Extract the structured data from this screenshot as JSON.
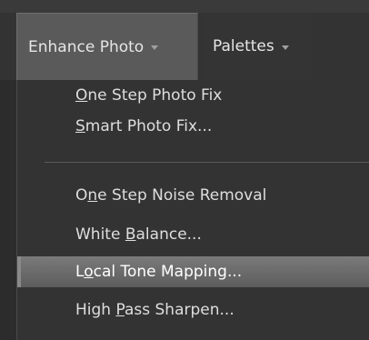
{
  "menubar": {
    "enhance_photo": "Enhance Photo",
    "palettes": "Palettes"
  },
  "dropdown": {
    "items": [
      {
        "pre": "",
        "u": "O",
        "post": "ne Step Photo Fix"
      },
      {
        "pre": "",
        "u": "S",
        "post": "mart Photo Fix..."
      },
      {
        "pre": "O",
        "u": "n",
        "post": "e Step Noise Removal"
      },
      {
        "pre": "White ",
        "u": "B",
        "post": "alance..."
      },
      {
        "pre": "L",
        "u": "o",
        "post": "cal Tone Mapping..."
      },
      {
        "pre": "High ",
        "u": "P",
        "post": "ass Sharpen..."
      }
    ],
    "highlighted_index": 4
  }
}
